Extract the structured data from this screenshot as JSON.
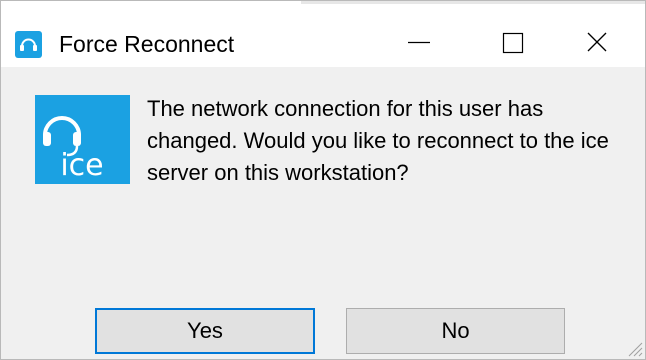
{
  "window": {
    "title": "Force Reconnect"
  },
  "icons": {
    "app": "headset-icon",
    "logo": "ice-logo-icon",
    "minimize": "minimize-icon",
    "maximize": "maximize-icon",
    "close": "close-icon",
    "grip": "resize-grip-icon"
  },
  "logo": {
    "text": "ice"
  },
  "message": {
    "text": "The network connection for this user has changed.  Would you like to reconnect to the ice server on this workstation?"
  },
  "buttons": {
    "yes": "Yes",
    "no": "No"
  },
  "colors": {
    "brand": "#1ba1e2",
    "focus": "#0078d7",
    "button": "#e1e1e1",
    "background": "#f0f0f0"
  }
}
